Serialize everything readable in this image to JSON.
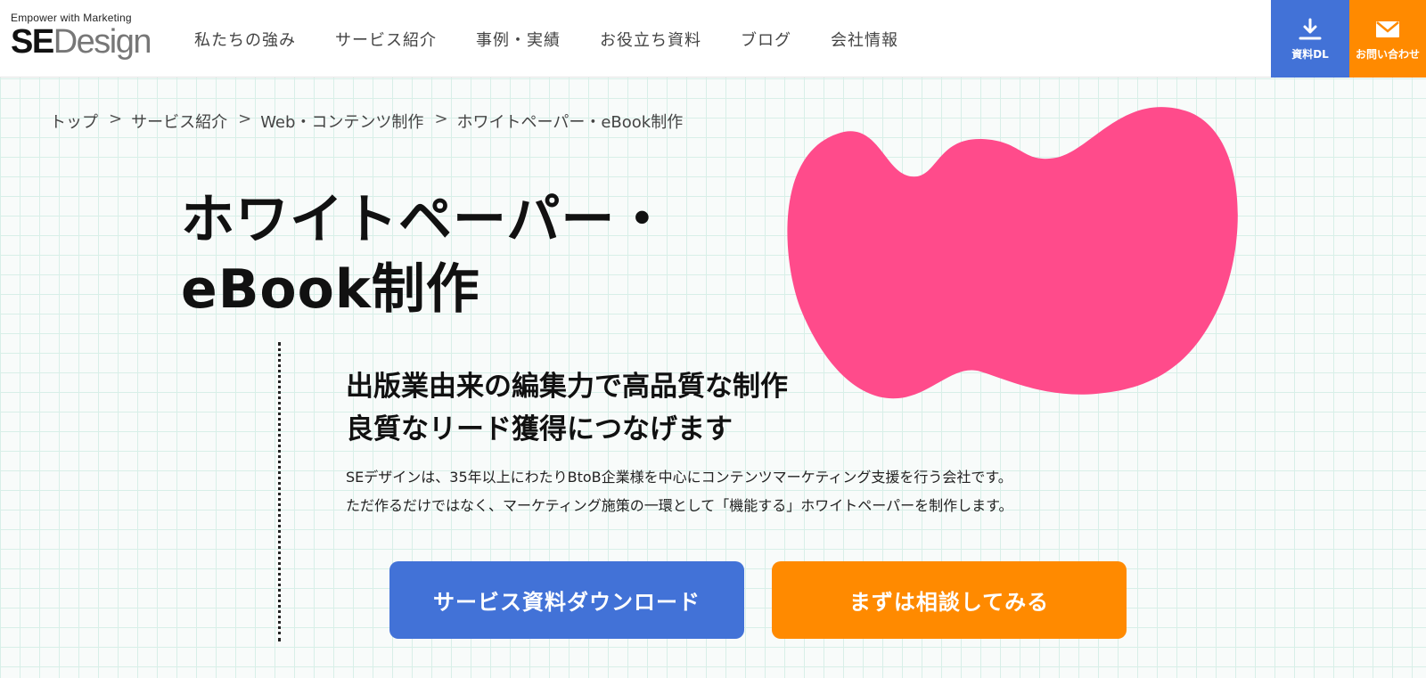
{
  "header": {
    "logo": {
      "tagline": "Empower with Marketing",
      "brand_bold": "SE",
      "brand_light": "Design"
    },
    "nav": [
      "私たちの強み",
      "サービス紹介",
      "事例・実績",
      "お役立ち資料",
      "ブログ",
      "会社情報"
    ],
    "cta_download": {
      "label": "資料DL",
      "icon": "download-icon",
      "color": "#4272d7"
    },
    "cta_contact": {
      "label": "お問い合わせ",
      "icon": "mail-icon",
      "color": "#ff8a00"
    }
  },
  "breadcrumb": {
    "separator": ">",
    "items": [
      "トップ",
      "サービス紹介",
      "Web・コンテンツ制作",
      "ホワイトペーパー・eBook制作"
    ]
  },
  "hero": {
    "title_line1": "ホワイトペーパー・",
    "title_line2": "eBook制作",
    "subheading_line1": "出版業由来の編集力で高品質な制作",
    "subheading_line2": "良質なリード獲得につなげます",
    "description_line1": "SEデザインは、35年以上にわたりBtoB企業様を中心にコンテンツマーケティング支援を行う会社です。",
    "description_line2": "ただ作るだけではなく、マーケティング施策の一環として「機能する」ホワイトペーパーを制作します。",
    "blob_color": "#ff4b8b"
  },
  "buttons": {
    "download_label": "サービス資料ダウンロード",
    "consult_label": "まずは相談してみる"
  }
}
